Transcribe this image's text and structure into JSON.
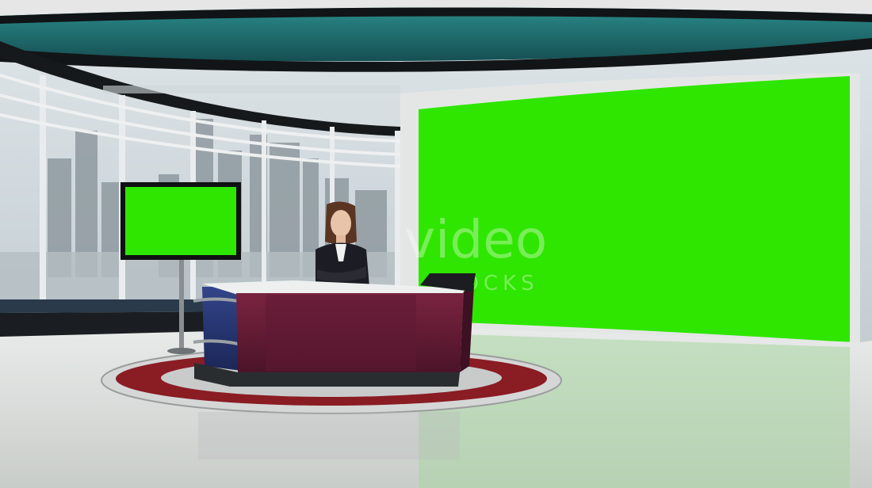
{
  "scene": {
    "watermark": {
      "brand": "video",
      "subline": "BLOCKS"
    }
  },
  "colors": {
    "chroma_green": "#2fe600",
    "ceiling_teal": "#1f6f6f",
    "desk_maroon": "#6a1f3a",
    "desk_blue": "#2a3a78",
    "floor_ring_red": "#8a1c24",
    "floor": "#d9dcd9"
  },
  "icons": [
    "green-screen-icon",
    "monitor-icon"
  ]
}
